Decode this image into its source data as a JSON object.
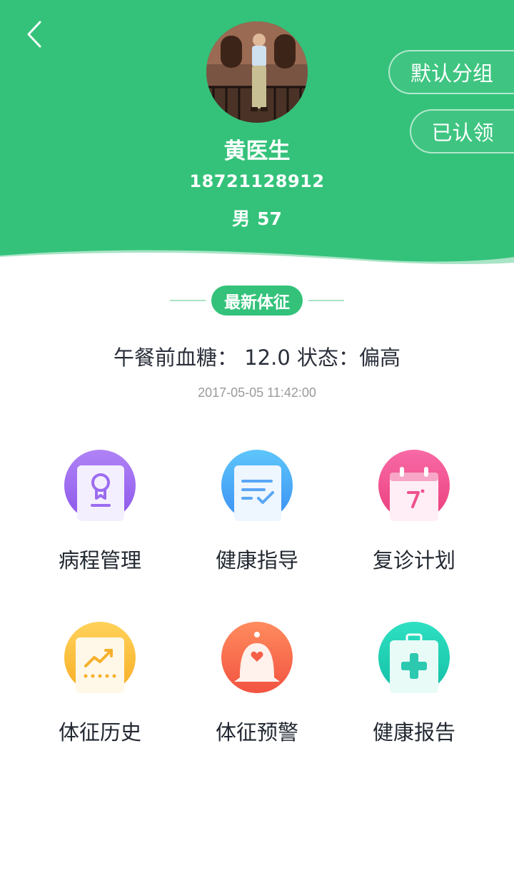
{
  "profile": {
    "name": "黄医生",
    "phone": "18721128912",
    "gender": "男",
    "age": "57"
  },
  "actions": {
    "group_label": "默认分组",
    "claimed_label": "已认领"
  },
  "vitals": {
    "section_title": "最新体征",
    "item_label": "午餐前血糖：",
    "value": "12.0",
    "status_label": "状态：",
    "status_value": "偏高",
    "time": "2017-05-05 11:42:00"
  },
  "menu": [
    {
      "label": "病程管理",
      "icon": "certificate-icon",
      "color": "#9b6cf0"
    },
    {
      "label": "健康指导",
      "icon": "checklist-icon",
      "color": "#43a6f6"
    },
    {
      "label": "复诊计划",
      "icon": "calendar-icon",
      "color": "#f0508f"
    },
    {
      "label": "体征历史",
      "icon": "trend-chart-icon",
      "color": "#fbbd3c"
    },
    {
      "label": "体征预警",
      "icon": "alarm-bell-icon",
      "color": "#f76a4c"
    },
    {
      "label": "健康报告",
      "icon": "medical-kit-icon",
      "color": "#1fd0b4"
    }
  ],
  "colors": {
    "brand": "#34c27a"
  }
}
